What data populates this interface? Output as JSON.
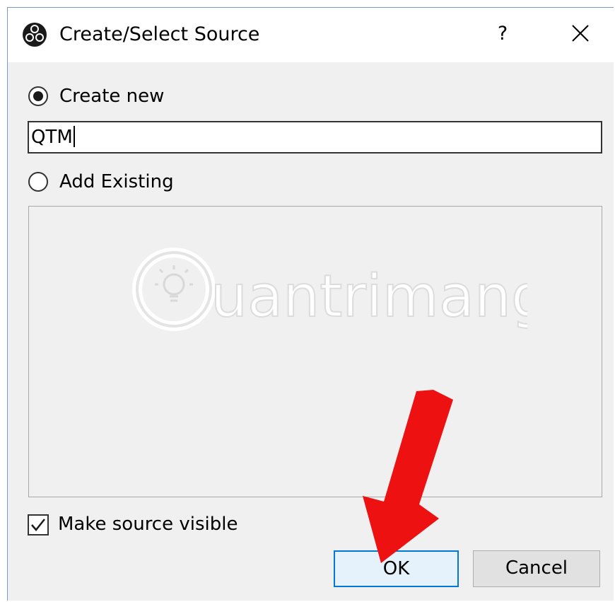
{
  "dialog": {
    "title": "Create/Select Source",
    "help_label": "?",
    "close_icon": "close-icon",
    "app_icon": "obs-logo-icon"
  },
  "options": {
    "create_new_label": "Create new",
    "create_new_selected": true,
    "name_value": "QTM",
    "add_existing_label": "Add Existing",
    "add_existing_selected": false,
    "existing_items": []
  },
  "visibility": {
    "label": "Make source visible",
    "checked": true
  },
  "buttons": {
    "ok_label": "OK",
    "cancel_label": "Cancel"
  },
  "watermark": {
    "text": "uantrimang"
  },
  "colors": {
    "accent": "#0078d7",
    "annotation_arrow": "#ee1111"
  }
}
